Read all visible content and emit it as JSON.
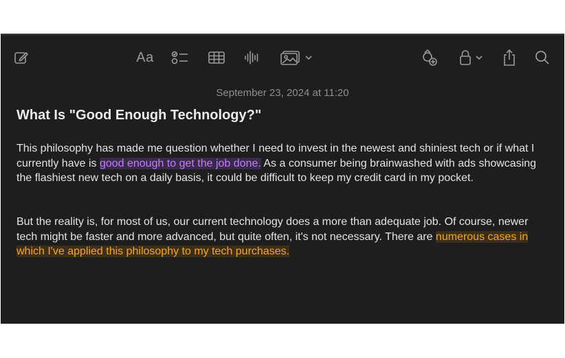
{
  "toolbar": {
    "new_note_icon": "compose-icon",
    "format_label": "Aa",
    "checklist_icon": "checklist-icon",
    "table_icon": "table-icon",
    "audio_icon": "audio-waveform-icon",
    "media_icon": "photo-icon",
    "collaborate_icon": "collaborate-icon",
    "lock_icon": "lock-icon",
    "share_icon": "share-icon",
    "search_icon": "search-icon"
  },
  "note": {
    "date": "September 23, 2024 at 11:20",
    "title": "What Is \"Good Enough Technology?\"",
    "paragraph1": {
      "before": "This philosophy has made me question whether I need to invest in the newest and shiniest tech or if what I currently have is ",
      "highlight": "good enough to get the job done.",
      "after": " As a consumer being brainwashed with ads showcasing the flashiest new tech on a daily basis, it could be difficult to keep my credit card in my pocket."
    },
    "paragraph2": {
      "before": "But the reality is, for most of us, our current technology does a more than adequate job. Of course, newer tech might be faster and more advanced, but quite often, it's not necessary. There are ",
      "highlight": "numerous cases in which I've applied this philosophy to my tech purchases."
    }
  },
  "colors": {
    "background": "#1e1e1e",
    "text": "#e4e4e4",
    "purple_highlight": "#c07bff",
    "orange_highlight": "#f5a623",
    "icon": "#9a9a9a"
  }
}
